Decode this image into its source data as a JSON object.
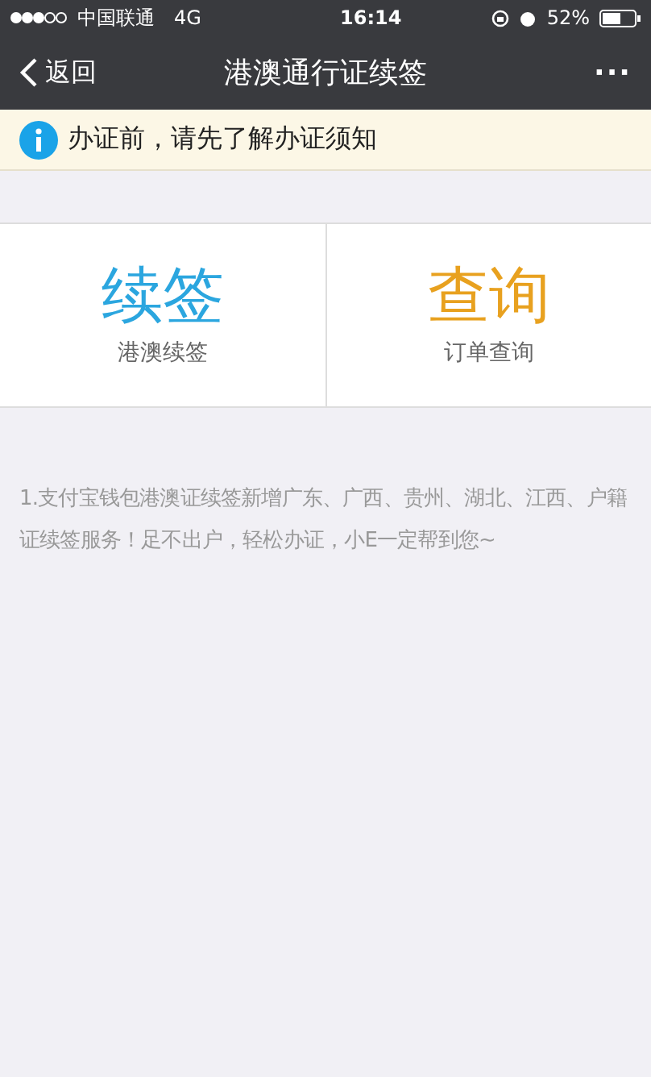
{
  "status_bar": {
    "carrier": "中国联通",
    "network": "4G",
    "time": "16:14",
    "battery": "52%"
  },
  "nav_bar": {
    "back": "返回",
    "title": "港澳通行证续签",
    "more": "···"
  },
  "notice": {
    "text": "办证前，请先了解办证须知"
  },
  "tiles": [
    {
      "title": "续签",
      "subtitle": "港澳续签",
      "color": "#2ba6df"
    },
    {
      "title": "查询",
      "subtitle": "订单查询",
      "color": "#e8a11f"
    }
  ],
  "announcement": "1.支付宝钱包港澳证续签新增广东、广西、贵州、湖北、江西、户籍证续签服务！足不出户，轻松办证，小E一定帮到您~"
}
